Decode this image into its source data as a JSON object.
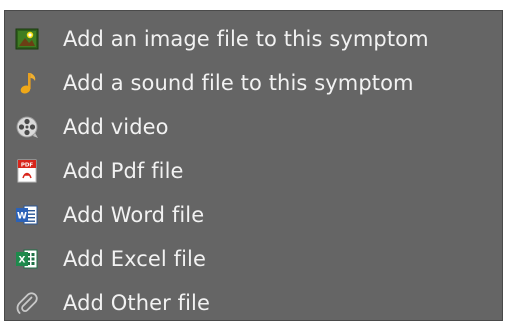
{
  "menu": {
    "items": [
      {
        "label": "Add an image file to this symptom",
        "icon": "image-icon"
      },
      {
        "label": "Add a sound file to this symptom",
        "icon": "music-note-icon"
      },
      {
        "label": "Add video",
        "icon": "film-reel-icon"
      },
      {
        "label": "Add Pdf file",
        "icon": "pdf-icon"
      },
      {
        "label": "Add Word file",
        "icon": "word-icon"
      },
      {
        "label": "Add Excel file",
        "icon": "excel-icon"
      },
      {
        "label": "Add Other file",
        "icon": "paperclip-icon"
      }
    ]
  }
}
